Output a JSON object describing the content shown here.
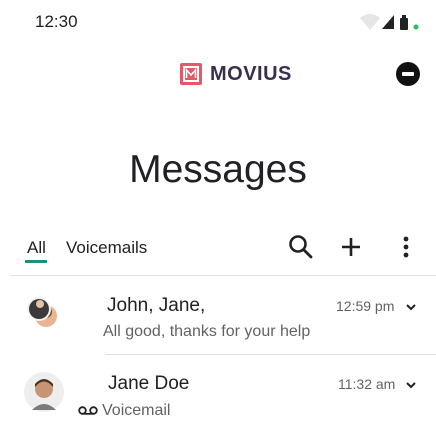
{
  "status_bar": {
    "time": "12:30"
  },
  "brand": {
    "name": "MOVIUS"
  },
  "page": {
    "title": "Messages"
  },
  "tabs": [
    {
      "label": "All",
      "active": true
    },
    {
      "label": "Voicemails",
      "active": false
    }
  ],
  "conversations": [
    {
      "name": "John, Jane,",
      "preview": "All good, thanks for your help",
      "time": "12:59 pm"
    },
    {
      "name": "Jane Doe",
      "preview": "Voicemail",
      "time": "11:32 am"
    }
  ],
  "colors": {
    "accent": "#1e8e7e",
    "brand_icon": "#e5576a",
    "brand_text": "#39304f"
  },
  "icons": [
    "search-icon",
    "plus-icon",
    "more-vert-icon",
    "chevron-down-icon",
    "voicemail-icon"
  ]
}
